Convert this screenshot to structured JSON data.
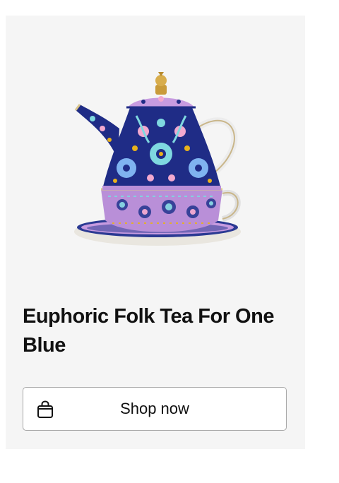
{
  "product": {
    "title": "Euphoric Folk Tea For One Blue",
    "image_alt": "Euphoric Folk Tea For One Blue"
  },
  "cta": {
    "label": "Shop now",
    "icon": "shopping-bag-icon"
  },
  "colors": {
    "card_background": "#f5f5f5",
    "teapot_navy": "#1f2c86",
    "cup_lilac": "#b98fd8",
    "accent_aqua": "#7fd8e0",
    "accent_yellow": "#e8b21c",
    "lid_gold": "#c99b3a",
    "button_border": "#a8a8a8"
  }
}
